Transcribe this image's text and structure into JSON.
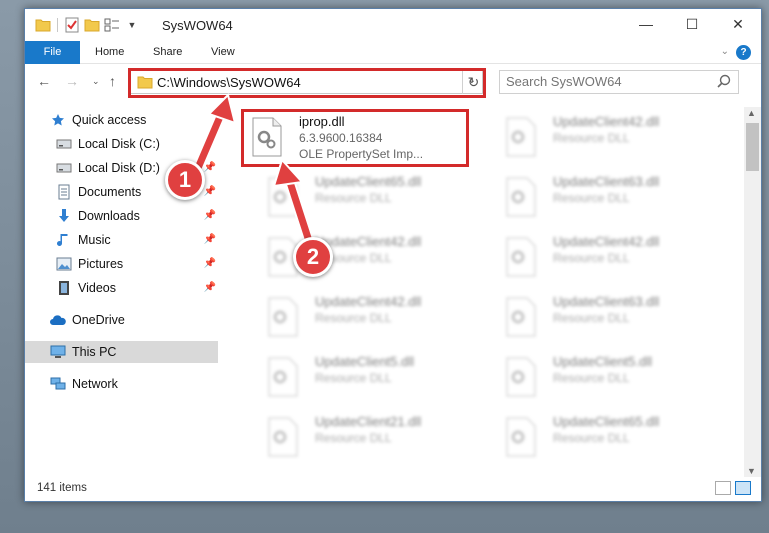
{
  "window": {
    "title": "SysWOW64"
  },
  "ribbon": {
    "tabs": [
      "File",
      "Home",
      "Share",
      "View"
    ]
  },
  "address": {
    "path": "C:\\Windows\\SysWOW64"
  },
  "search": {
    "placeholder": "Search SysWOW64"
  },
  "sidebar": {
    "items": [
      {
        "label": "Quick access",
        "icon": "star-icon",
        "pinned": false
      },
      {
        "label": "Local Disk (C:)",
        "icon": "drive-icon",
        "pinned": true
      },
      {
        "label": "Local Disk (D:)",
        "icon": "drive-icon",
        "pinned": true
      },
      {
        "label": "Documents",
        "icon": "documents-icon",
        "pinned": true
      },
      {
        "label": "Downloads",
        "icon": "download-icon",
        "pinned": true
      },
      {
        "label": "Music",
        "icon": "music-icon",
        "pinned": true
      },
      {
        "label": "Pictures",
        "icon": "pictures-icon",
        "pinned": true
      },
      {
        "label": "Videos",
        "icon": "video-icon",
        "pinned": true
      },
      {
        "label": "OneDrive",
        "icon": "cloud-icon",
        "pinned": false
      },
      {
        "label": "This PC",
        "icon": "computer-icon",
        "pinned": false,
        "selected": true
      },
      {
        "label": "Network",
        "icon": "network-icon",
        "pinned": false
      }
    ]
  },
  "files": {
    "highlighted": {
      "name": "iprop.dll",
      "version": "6.3.9600.16384",
      "description": "OLE PropertySet Imp..."
    },
    "blurred": [
      {
        "name": "UpdateClient42.dll",
        "type": "Resource DLL"
      },
      {
        "name": "UpdateClient65.dll",
        "type": "Resource DLL"
      },
      {
        "name": "UpdateClient63.dll",
        "type": "Resource DLL"
      },
      {
        "name": "UpdateClient42.dll",
        "type": "Resource DLL"
      },
      {
        "name": "UpdateClient42.dll",
        "type": "Resource DLL"
      },
      {
        "name": "UpdateClient42.dll",
        "type": "Resource DLL"
      },
      {
        "name": "UpdateClient63.dll",
        "type": "Resource DLL"
      },
      {
        "name": "UpdateClient5.dll",
        "type": "Resource DLL"
      },
      {
        "name": "UpdateClient5.dll",
        "type": "Resource DLL"
      },
      {
        "name": "UpdateClient21.dll",
        "type": "Resource DLL"
      },
      {
        "name": "UpdateClient65.dll",
        "type": "Resource DLL"
      }
    ]
  },
  "status": {
    "count": "141 items"
  },
  "annotations": {
    "step1": "1",
    "step2": "2",
    "color": "#d32a2a"
  }
}
